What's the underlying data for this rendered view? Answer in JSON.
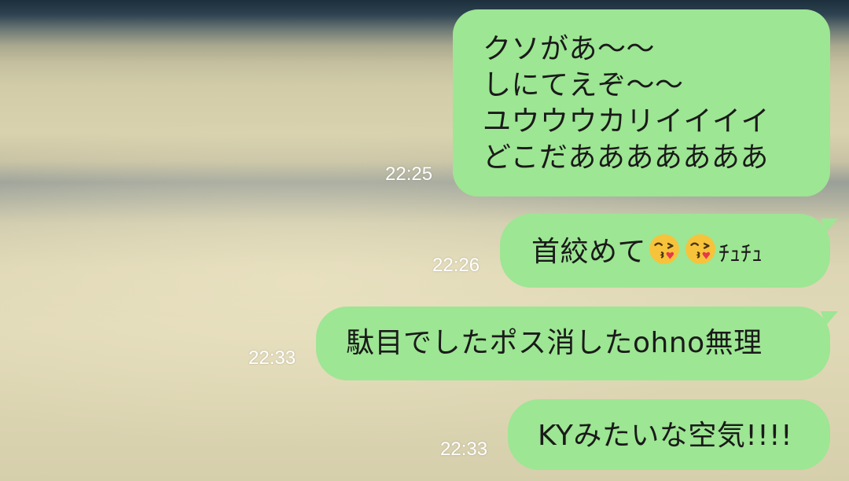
{
  "messages": [
    {
      "lines": [
        "クソがあ〜〜",
        "しにてえぞ〜〜",
        "ユウウウカリイイイイ",
        "どこだあああああああ"
      ],
      "time": "22:25"
    },
    {
      "text": "首絞めて",
      "emoji": [
        "face-throwing-kiss-icon",
        "face-throwing-kiss-icon"
      ],
      "suffix": "ﾁｭﾁｭ",
      "time": "22:26"
    },
    {
      "text": "駄目でしたポス消したohno無理",
      "time": "22:33"
    },
    {
      "text": "KYみたいな空気!!!!",
      "time": "22:33"
    }
  ],
  "colors": {
    "bubble": "#9de693",
    "text": "#1a1a1a",
    "time": "#ffffff"
  }
}
